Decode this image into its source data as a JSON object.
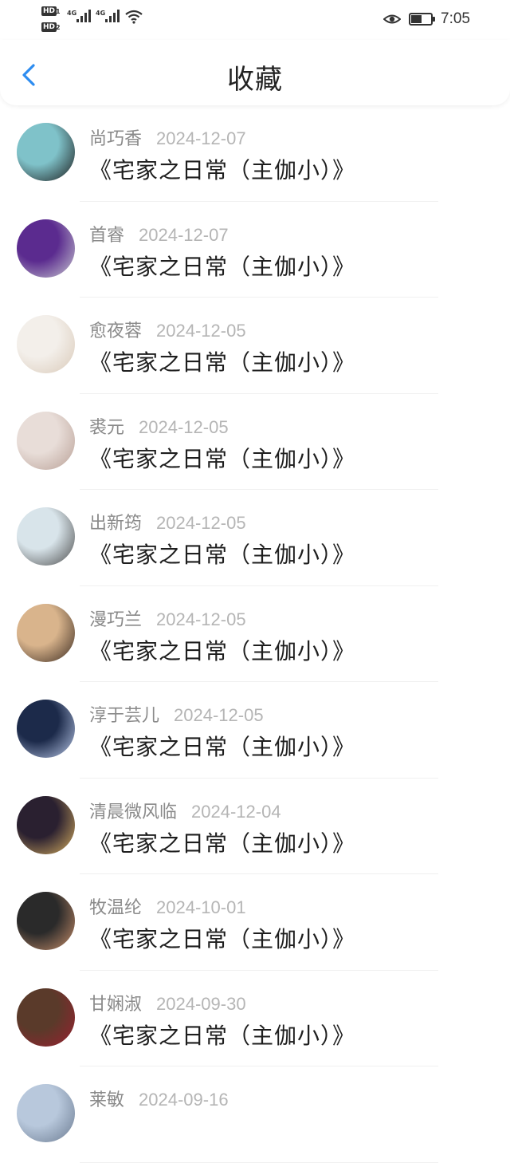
{
  "status_bar": {
    "left_badges": [
      "HD",
      "HD"
    ],
    "left_badge_subs": [
      "1",
      "2"
    ],
    "network_labels": [
      "4G",
      "4G"
    ],
    "time": "7:05",
    "icons": [
      "eye-icon",
      "battery-icon",
      "wifi-icon",
      "signal-icon"
    ]
  },
  "header": {
    "title": "收藏",
    "back_icon": "chevron-left-icon",
    "accent_color": "#2d8cf0"
  },
  "favorites": [
    {
      "name": "尚巧香",
      "date": "2024-12-07",
      "book": "《宅家之日常（主伽小）》",
      "avatar": [
        "#7fc2c9",
        "#1a1a1a"
      ]
    },
    {
      "name": "首睿",
      "date": "2024-12-07",
      "book": "《宅家之日常（主伽小）》",
      "avatar": [
        "#5b2b8f",
        "#c8c8d0"
      ]
    },
    {
      "name": "愈夜蓉",
      "date": "2024-12-05",
      "book": "《宅家之日常（主伽小）》",
      "avatar": [
        "#f3efea",
        "#d9c9b8"
      ]
    },
    {
      "name": "裘元",
      "date": "2024-12-05",
      "book": "《宅家之日常（主伽小）》",
      "avatar": [
        "#e8ddd8",
        "#b89f95"
      ]
    },
    {
      "name": "出新筠",
      "date": "2024-12-05",
      "book": "《宅家之日常（主伽小）》",
      "avatar": [
        "#d8e4ea",
        "#4a4a4a"
      ]
    },
    {
      "name": "漫巧兰",
      "date": "2024-12-05",
      "book": "《宅家之日常（主伽小）》",
      "avatar": [
        "#d9b48c",
        "#3a2a20"
      ]
    },
    {
      "name": "淳于芸儿",
      "date": "2024-12-05",
      "book": "《宅家之日常（主伽小）》",
      "avatar": [
        "#1c2a4a",
        "#b9c8e8"
      ]
    },
    {
      "name": "清晨微风临",
      "date": "2024-12-04",
      "book": "《宅家之日常（主伽小）》",
      "avatar": [
        "#2a2030",
        "#d8b060"
      ]
    },
    {
      "name": "牧温纶",
      "date": "2024-10-01",
      "book": "《宅家之日常（主伽小）》",
      "avatar": [
        "#2a2a2a",
        "#c98f6a"
      ]
    },
    {
      "name": "甘娴淑",
      "date": "2024-09-30",
      "book": "《宅家之日常（主伽小）》",
      "avatar": [
        "#5a3a2a",
        "#9a2030"
      ]
    },
    {
      "name": "莱敏",
      "date": "2024-09-16",
      "book": "",
      "avatar": [
        "#b8c8dc",
        "#6a7a90"
      ]
    }
  ]
}
